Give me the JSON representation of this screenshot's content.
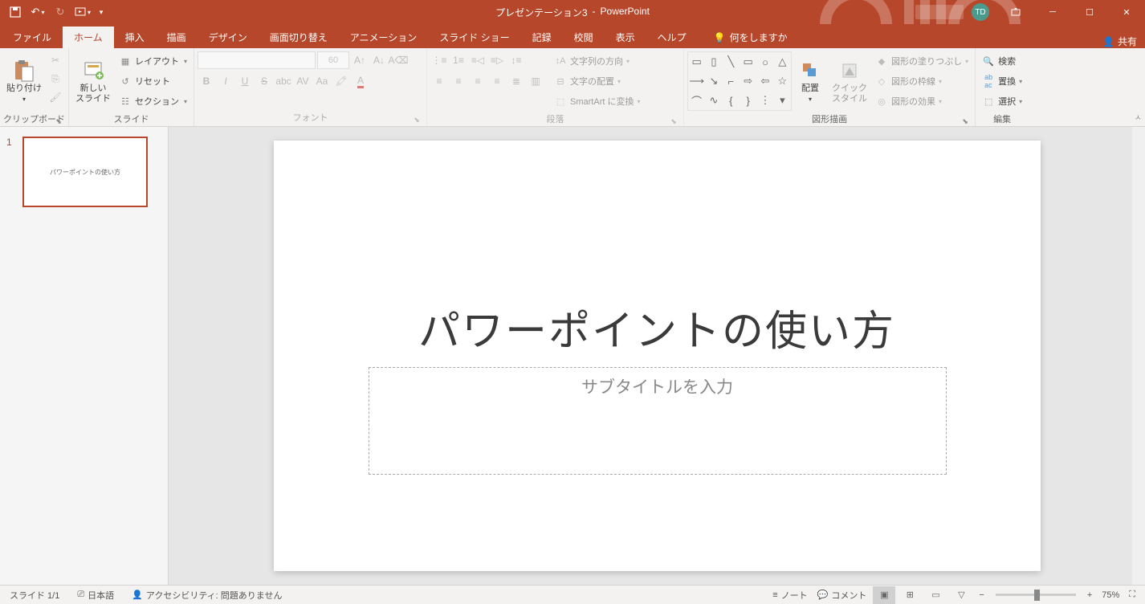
{
  "title": {
    "doc": "プレゼンテーション3",
    "app": "PowerPoint",
    "user_initials": "TD"
  },
  "qat": {
    "save": "保存",
    "undo": "↶",
    "redo": "↻",
    "start": "▷"
  },
  "tabs": {
    "file": "ファイル",
    "home": "ホーム",
    "insert": "挿入",
    "draw": "描画",
    "design": "デザイン",
    "transitions": "画面切り替え",
    "animations": "アニメーション",
    "slideshow": "スライド ショー",
    "record": "記録",
    "review": "校閲",
    "view": "表示",
    "help": "ヘルプ",
    "tellme": "何をしますか",
    "share": "共有"
  },
  "ribbon": {
    "clipboard": {
      "label": "クリップボード",
      "paste": "貼り付け"
    },
    "slides": {
      "label": "スライド",
      "new_slide": "新しい\nスライド",
      "layout": "レイアウト",
      "reset": "リセット",
      "section": "セクション"
    },
    "font": {
      "label": "フォント",
      "size": "60"
    },
    "paragraph": {
      "label": "段落",
      "text_dir": "文字列の方向",
      "align_text": "文字の配置",
      "smartart": "SmartArt に変換"
    },
    "drawing": {
      "label": "図形描画",
      "arrange": "配置",
      "quick_styles": "クイック\nスタイル",
      "fill": "図形の塗りつぶし",
      "outline": "図形の枠線",
      "effects": "図形の効果"
    },
    "editing": {
      "label": "編集",
      "find": "検索",
      "replace": "置換",
      "select": "選択"
    }
  },
  "slide": {
    "number": "1",
    "title_text": "パワーポイントの使い方",
    "subtitle_placeholder": "サブタイトルを入力",
    "thumb_text": "パワーポイントの使い方"
  },
  "status": {
    "slide_count": "スライド 1/1",
    "language": "日本語",
    "accessibility": "アクセシビリティ: 問題ありません",
    "notes": "ノート",
    "comments": "コメント",
    "zoom": "75%"
  }
}
